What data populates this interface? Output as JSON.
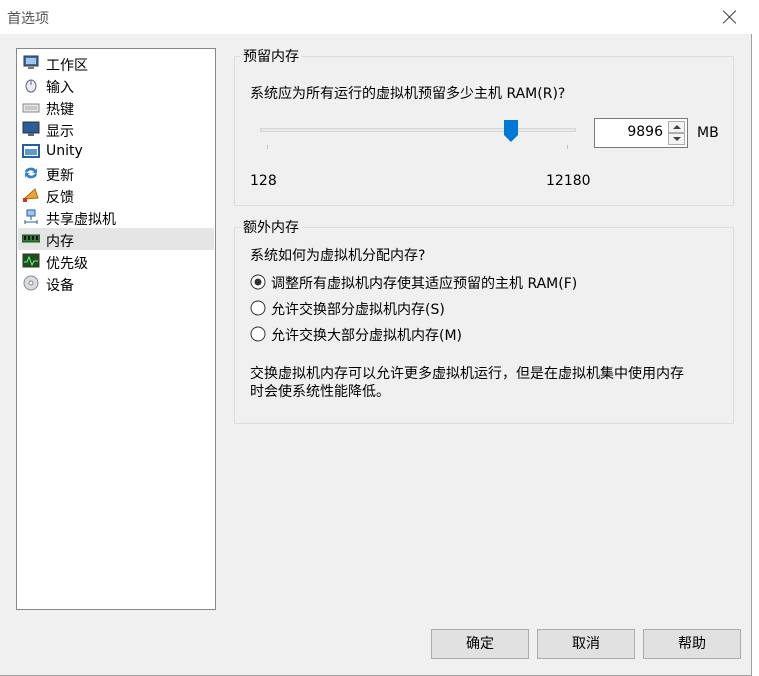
{
  "window": {
    "title": "首选项"
  },
  "sidebar": {
    "items": [
      {
        "label": "工作区",
        "icon": "monitor-workspace-icon"
      },
      {
        "label": "输入",
        "icon": "mouse-icon"
      },
      {
        "label": "热键",
        "icon": "keyboard-icon"
      },
      {
        "label": "显示",
        "icon": "display-icon"
      },
      {
        "label": "Unity",
        "icon": "unity-window-icon"
      },
      {
        "label": "更新",
        "icon": "update-arrows-icon"
      },
      {
        "label": "反馈",
        "icon": "megaphone-icon"
      },
      {
        "label": "共享虚拟机",
        "icon": "network-share-icon"
      },
      {
        "label": "内存",
        "icon": "memory-chip-icon"
      },
      {
        "label": "优先级",
        "icon": "performance-monitor-icon"
      },
      {
        "label": "设备",
        "icon": "disc-icon"
      }
    ],
    "selected": "内存"
  },
  "reserved": {
    "group_title": "预留内存",
    "question": "系统应为所有运行的虚拟机预留多少主机 RAM(R)?",
    "min_label": "128",
    "max_label": "12180",
    "min": 128,
    "max": 12180,
    "value": 9896,
    "value_text": "9896",
    "unit": "MB"
  },
  "extra": {
    "group_title": "额外内存",
    "question": "系统如何为虚拟机分配内存?",
    "options": [
      {
        "label": "调整所有虚拟机内存使其适应预留的主机 RAM(F)",
        "checked": true
      },
      {
        "label": "允许交换部分虚拟机内存(S)",
        "checked": false
      },
      {
        "label": "允许交换大部分虚拟机内存(M)",
        "checked": false
      }
    ],
    "note_line1": "交换虚拟机内存可以允许更多虚拟机运行，但是在虚拟机集中使用内存",
    "note_line2": "时会使系统性能降低。"
  },
  "buttons": {
    "ok": "确定",
    "cancel": "取消",
    "help": "帮助"
  },
  "colors": {
    "accent": "#0078d7",
    "selection": "#e5e5e5"
  }
}
